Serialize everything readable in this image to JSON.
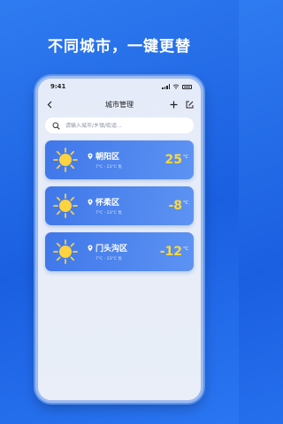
{
  "headline": "不同城市，一键更替",
  "status_bar": {
    "time": "9:41"
  },
  "nav": {
    "title": "城市管理"
  },
  "search": {
    "placeholder": "请输入城市/乡镇/街道..."
  },
  "colors": {
    "background": "#1a5fe0",
    "card": "#4a83ee",
    "temperature": "#ffd83a"
  },
  "cities": [
    {
      "name": "朝阳区",
      "range": "7°C - 23°C",
      "condition": "优",
      "temp": "25",
      "unit": "°C",
      "icon": "sun-icon"
    },
    {
      "name": "怀柔区",
      "range": "7°C - 23°C",
      "condition": "优",
      "temp": "-8",
      "unit": "°C",
      "icon": "sun-icon"
    },
    {
      "name": "门头沟区",
      "range": "7°C - 23°C",
      "condition": "优",
      "temp": "-12",
      "unit": "°C",
      "icon": "sun-icon"
    }
  ]
}
